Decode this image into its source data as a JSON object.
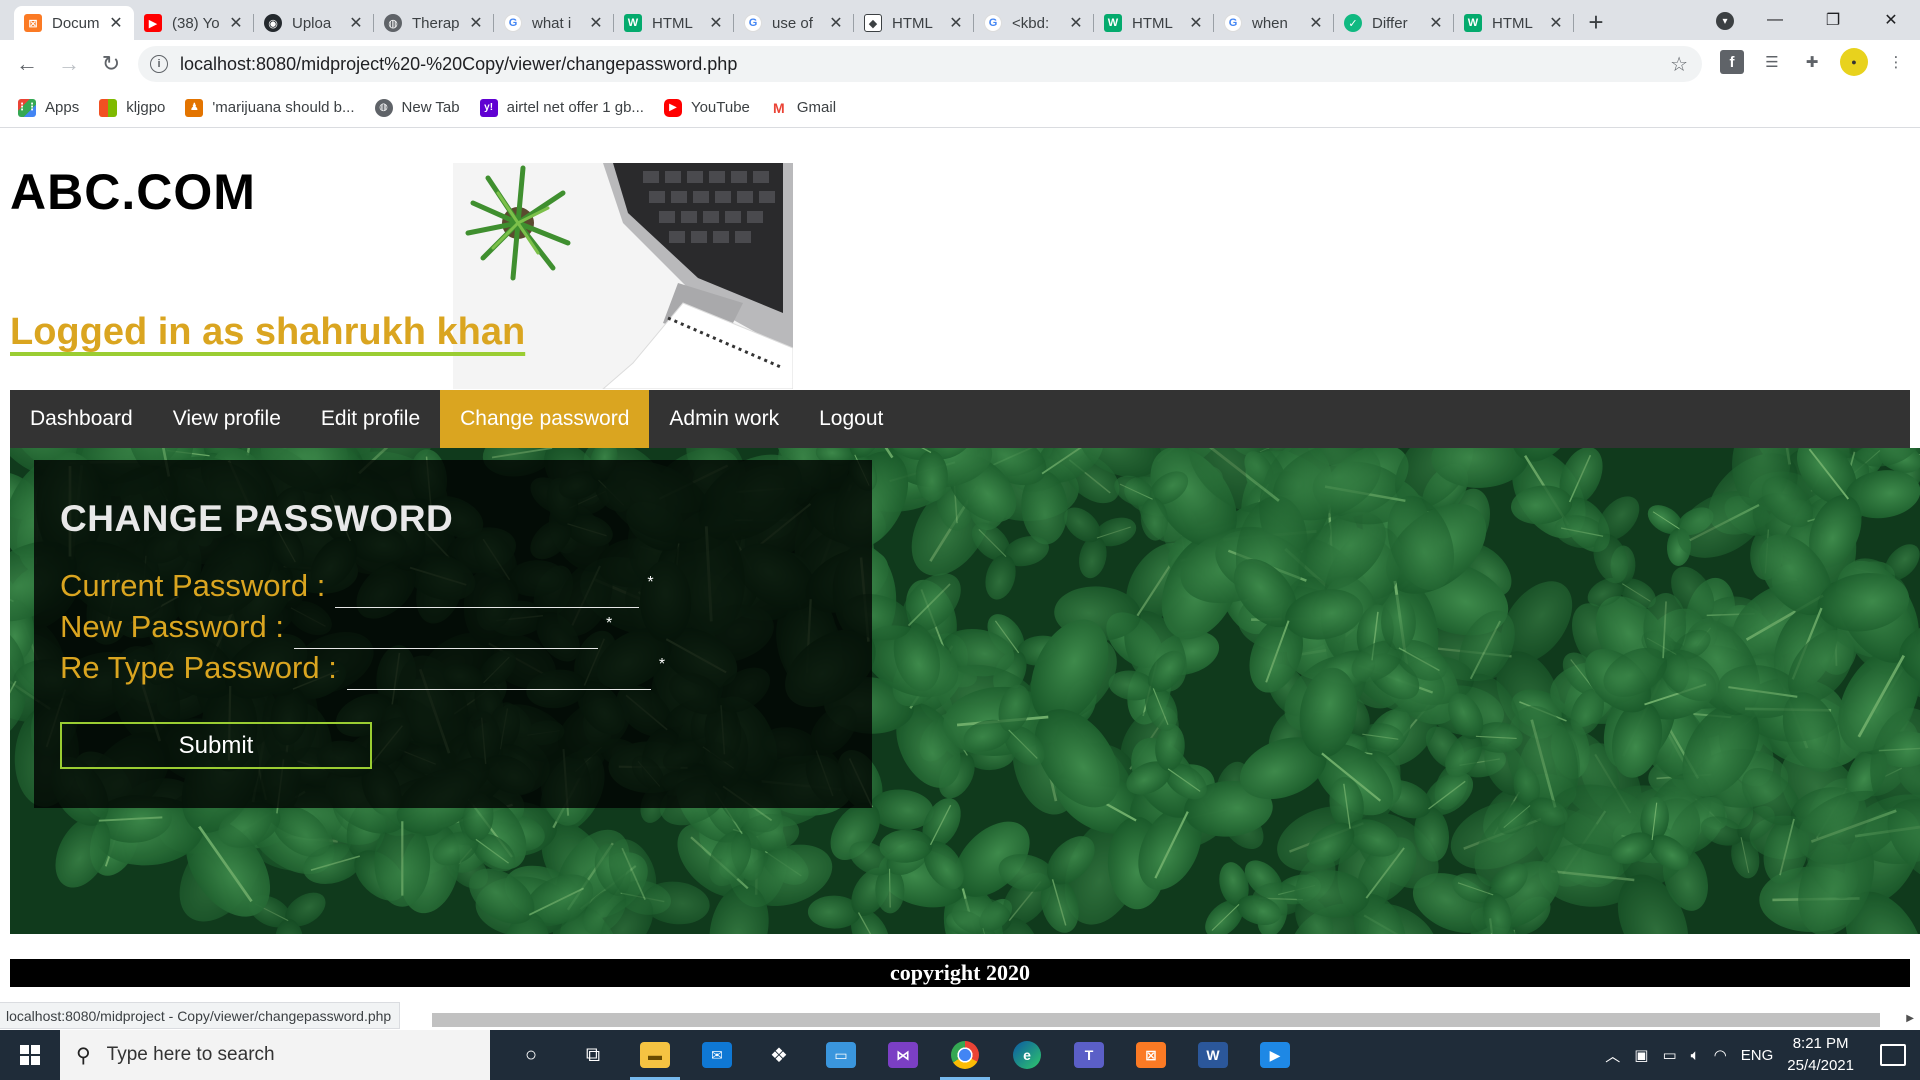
{
  "browser": {
    "tabs": [
      {
        "title": "Docum",
        "icon": "xampp-icon",
        "color": "#fb7a24",
        "active": true
      },
      {
        "title": "(38) Yo",
        "icon": "youtube-icon",
        "color": "#ff0000"
      },
      {
        "title": "Uploa",
        "icon": "github-icon",
        "color": "#24292e"
      },
      {
        "title": "Therap",
        "icon": "globe-icon",
        "color": "#5f6368"
      },
      {
        "title": "what i",
        "icon": "google-icon",
        "color": "#4285f4"
      },
      {
        "title": "HTML",
        "icon": "w3schools-icon",
        "color": "#04aa6d"
      },
      {
        "title": "use of",
        "icon": "google-icon",
        "color": "#4285f4"
      },
      {
        "title": "HTML",
        "icon": "diamond-icon",
        "color": "#3c4043"
      },
      {
        "title": "<kbd:",
        "icon": "google-icon",
        "color": "#4285f4"
      },
      {
        "title": "HTML",
        "icon": "w3schools-icon",
        "color": "#04aa6d"
      },
      {
        "title": "when",
        "icon": "google-icon",
        "color": "#4285f4"
      },
      {
        "title": "Differ",
        "icon": "shield-icon",
        "color": "#10b981"
      },
      {
        "title": "HTML",
        "icon": "w3schools-icon",
        "color": "#04aa6d"
      }
    ],
    "url": "localhost:8080/midproject%20-%20Copy/viewer/changepassword.php",
    "bookmarks": [
      {
        "label": "Apps",
        "icon": "apps-grid-icon",
        "color": "#ea4335"
      },
      {
        "label": "kljgpo",
        "icon": "windows-icon",
        "color": "#f25022"
      },
      {
        "label": "'marijuana should b...",
        "icon": "debate-icon",
        "color": "#e37400"
      },
      {
        "label": "New Tab",
        "icon": "globe-icon",
        "color": "#5f6368"
      },
      {
        "label": "airtel net offer 1 gb...",
        "icon": "yahoo-icon",
        "color": "#6001d2"
      },
      {
        "label": "YouTube",
        "icon": "youtube-icon",
        "color": "#ff0000"
      },
      {
        "label": "Gmail",
        "icon": "gmail-icon",
        "color": "#ea4335"
      }
    ],
    "status_url": "localhost:8080/midproject - Copy/viewer/changepassword.php"
  },
  "page": {
    "site_name": "ABC.COM",
    "logged_in_text": "Logged in as shahrukh khan",
    "nav": [
      "Dashboard",
      "View profile",
      "Edit profile",
      "Change password",
      "Admin work",
      "Logout"
    ],
    "active_nav": "Change password",
    "form": {
      "title": "CHANGE PASSWORD",
      "current_label": "Current Password :",
      "new_label": "New Password :",
      "retype_label": "Re Type Password :",
      "required_mark": "*",
      "submit_label": "Submit"
    },
    "footer": "copyright 2020",
    "colors": {
      "accent": "#daa520",
      "underline": "#9acd32",
      "nav_bg": "#333333",
      "footer_bg": "#000000"
    }
  },
  "taskbar": {
    "search_placeholder": "Type here to search",
    "language": "ENG",
    "time": "8:21 PM",
    "date": "25/4/2021"
  }
}
